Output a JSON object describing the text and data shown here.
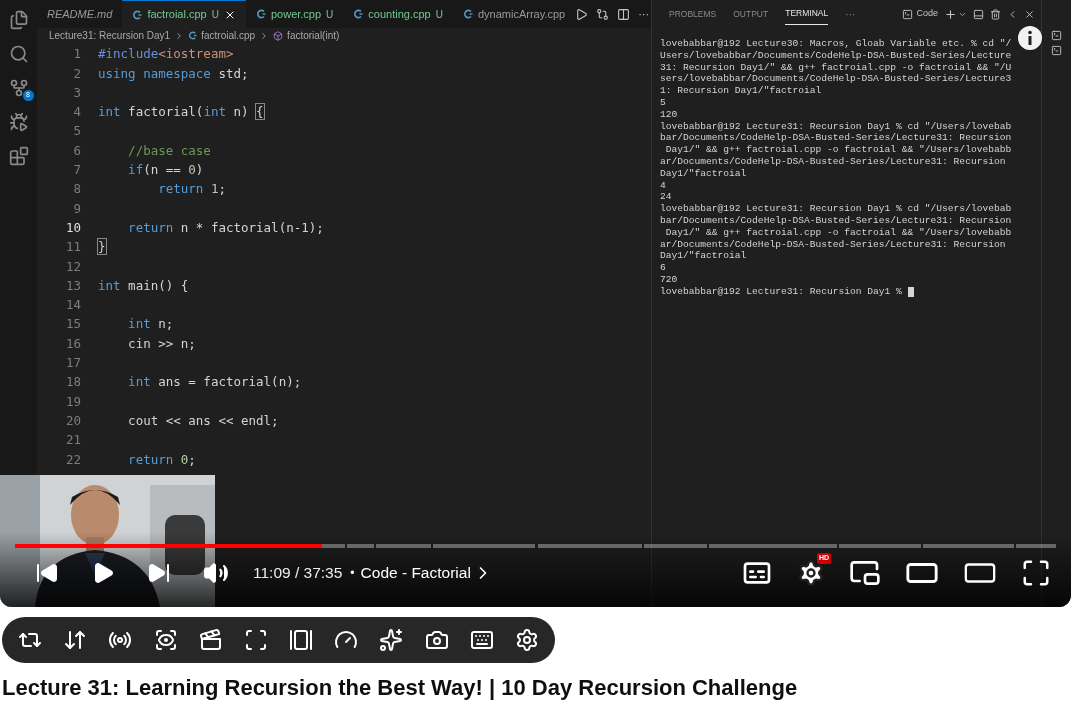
{
  "video": {
    "editor": {
      "activity_badge": "8",
      "tabs": [
        {
          "label": "README.md",
          "kind": "markdown",
          "preview": true,
          "selected": false
        },
        {
          "label": "factroial.cpp",
          "kind": "cpp",
          "badge": "U",
          "preview": false,
          "selected": true
        },
        {
          "label": "power.cpp",
          "kind": "cpp",
          "badge": "U",
          "preview": false,
          "selected": false
        },
        {
          "label": "counting.cpp",
          "kind": "cpp",
          "badge": "U",
          "preview": false,
          "selected": false
        },
        {
          "label": "dynamicArray.cpp",
          "kind": "cpp",
          "preview": false,
          "selected": false
        }
      ],
      "tab_more": "···",
      "breadcrumb": [
        {
          "label": "Lecture31: Recursion Day1",
          "kind": "folder"
        },
        {
          "label": "factroial.cpp",
          "kind": "file"
        },
        {
          "label": "factorial(int)",
          "kind": "symbol"
        }
      ],
      "lines": [
        {
          "number": "1",
          "current": false,
          "tokens": [
            {
              "kind": "dir",
              "t": "#include"
            },
            {
              "kind": "str",
              "t": "<iostream>"
            }
          ]
        },
        {
          "number": "2",
          "current": false,
          "tokens": [
            {
              "kind": "kw",
              "t": "using namespace "
            },
            {
              "kind": "plain",
              "t": "std;"
            }
          ]
        },
        {
          "number": "3",
          "current": false
        },
        {
          "number": "4",
          "current": false,
          "tokens": [
            {
              "kind": "kw",
              "t": "int "
            },
            {
              "kind": "plain",
              "t": "factorial("
            },
            {
              "kind": "kw",
              "t": "int "
            },
            {
              "kind": "plain",
              "t": "n) "
            },
            {
              "kind": "match",
              "t": "{"
            }
          ]
        },
        {
          "number": "5",
          "current": false
        },
        {
          "number": "6",
          "current": false,
          "tokens": [
            {
              "kind": "comment",
              "t": "    //base case"
            }
          ]
        },
        {
          "number": "7",
          "current": false,
          "tokens": [
            {
              "kind": "kw",
              "t": "    if"
            },
            {
              "kind": "plain",
              "t": "(n == "
            },
            {
              "kind": "num",
              "t": "0"
            },
            {
              "kind": "plain",
              "t": ")"
            }
          ]
        },
        {
          "number": "8",
          "current": false,
          "tokens": [
            {
              "kind": "kw",
              "t": "        return "
            },
            {
              "kind": "num",
              "t": "1"
            },
            {
              "kind": "plain",
              "t": ";"
            }
          ]
        },
        {
          "number": "9",
          "current": false
        },
        {
          "number": "10",
          "current": true,
          "tokens": [
            {
              "kind": "kw",
              "t": "    return "
            },
            {
              "kind": "plain",
              "t": "n * factorial(n-1);"
            }
          ]
        },
        {
          "number": "11",
          "current": false,
          "tokens": [
            {
              "kind": "match",
              "t": "}"
            }
          ]
        },
        {
          "number": "12",
          "current": false
        },
        {
          "number": "13",
          "current": false,
          "tokens": [
            {
              "kind": "kw",
              "t": "int "
            },
            {
              "kind": "plain",
              "t": "main() {"
            }
          ]
        },
        {
          "number": "14",
          "current": false
        },
        {
          "number": "15",
          "current": false,
          "tokens": [
            {
              "kind": "kw",
              "t": "    int "
            },
            {
              "kind": "plain",
              "t": "n;"
            }
          ]
        },
        {
          "number": "16",
          "current": false,
          "tokens": [
            {
              "kind": "plain",
              "t": "    cin >> n;"
            }
          ]
        },
        {
          "number": "17",
          "current": false
        },
        {
          "number": "18",
          "current": false,
          "tokens": [
            {
              "kind": "kw",
              "t": "    int "
            },
            {
              "kind": "plain",
              "t": "ans = factorial(n);"
            }
          ]
        },
        {
          "number": "19",
          "current": false
        },
        {
          "number": "20",
          "current": false,
          "tokens": [
            {
              "kind": "plain",
              "t": "    cout << ans << endl;"
            }
          ]
        },
        {
          "number": "21",
          "current": false
        },
        {
          "number": "22",
          "current": false,
          "tokens": [
            {
              "kind": "kw",
              "t": "    return "
            },
            {
              "kind": "num",
              "t": "0"
            },
            {
              "kind": "plain",
              "t": ";"
            }
          ]
        }
      ]
    },
    "panel": {
      "tabs": [
        {
          "label": "PROBLEMS",
          "selected": false
        },
        {
          "label": "OUTPUT",
          "selected": false
        },
        {
          "label": "TERMINAL",
          "selected": true
        }
      ],
      "more": "···",
      "terminal_name": "Code",
      "lines": [
        "lovebabbar@192 Lecture30: Macros, Gloab Variable etc. % cd \"/",
        "Users/lovebabbar/Documents/CodeHelp-DSA-Busted-Series/Lecture",
        "31: Recursion Day1/\" && g++ factroial.cpp -o factroial && \"/U",
        "sers/lovebabbar/Documents/CodeHelp-DSA-Busted-Series/Lecture3",
        "1: Recursion Day1/\"factroial",
        "5",
        "120",
        "lovebabbar@192 Lecture31: Recursion Day1 % cd \"/Users/lovebab",
        "bar/Documents/CodeHelp-DSA-Busted-Series/Lecture31: Recursion",
        " Day1/\" && g++ factroial.cpp -o factroial && \"/Users/lovebabb",
        "ar/Documents/CodeHelp-DSA-Busted-Series/Lecture31: Recursion",
        "Day1/\"factroial",
        "4",
        "24",
        "lovebabbar@192 Lecture31: Recursion Day1 % cd \"/Users/lovebab",
        "bar/Documents/CodeHelp-DSA-Busted-Series/Lecture31: Recursion",
        " Day1/\" && g++ factroial.cpp -o factroial && \"/Users/lovebabb",
        "ar/Documents/CodeHelp-DSA-Busted-Series/Lecture31: Recursion",
        "Day1/\"factroial",
        "6",
        "720",
        "lovebabbar@192 Lecture31: Recursion Day1 % "
      ]
    }
  },
  "player": {
    "progress": {
      "level": 0.295
    },
    "time": "11:09 / 37:35",
    "separator": "•",
    "chapter": "Code - Factorial",
    "hd_badge": "HD"
  },
  "title": "Lecture 31: Learning Recursion the Best Way! | 10 Day Recursion Challenge"
}
